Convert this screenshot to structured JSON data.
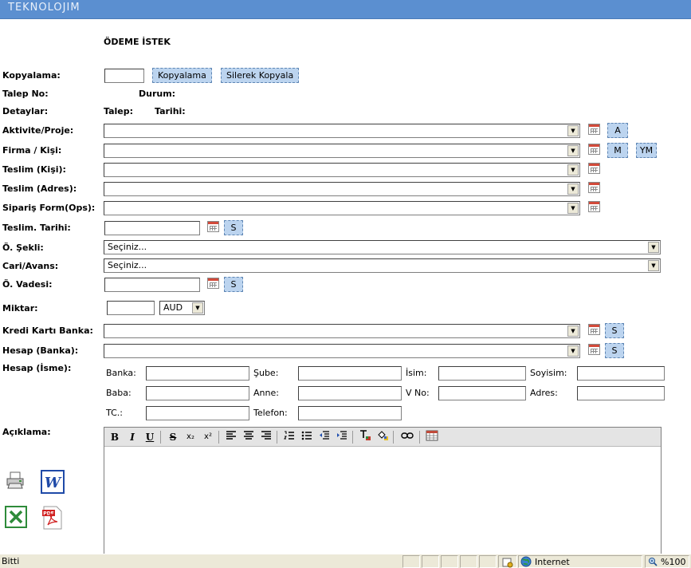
{
  "brand": "TEKNOLOJIM",
  "form_title": "ÖDEME İSTEK",
  "labels": {
    "kopyalama": "Kopyalama:",
    "talep_no": "Talep No:",
    "durum": "Durum:",
    "detaylar": "Detaylar:",
    "talep": "Talep:",
    "tarihi": "Tarihi:",
    "aktivite": "Aktivite/Proje:",
    "firma": "Firma / Kişi:",
    "teslim_kisi": "Teslim (Kişi):",
    "teslim_adres": "Teslim (Adres):",
    "siparis": "Sipariş Form(Ops):",
    "teslim_tarihi": "Teslim. Tarihi:",
    "o_sekli": "Ö. Şekli:",
    "cari": "Cari/Avans:",
    "o_vadesi": "Ö. Vadesi:",
    "miktar": "Miktar:",
    "kredi": "Kredi Kartı Banka:",
    "hesap_banka": "Hesap (Banka):",
    "hesap_isme": "Hesap (İsme):",
    "aciklama": "Açıklama:"
  },
  "buttons": {
    "kopyalama": "Kopyalama",
    "silerek": "Silerek Kopyala",
    "a": "A",
    "m": "M",
    "ym": "YM",
    "s": "S"
  },
  "selects": {
    "o_sekli": "Seçiniz...",
    "cari": "Seçiniz...",
    "currency": "AUD"
  },
  "hesap_fields": {
    "banka": "Banka:",
    "sube": "Şube:",
    "isim": "İsim:",
    "soyisim": "Soyisim:",
    "baba": "Baba:",
    "anne": "Anne:",
    "v_no": "V No:",
    "adres": "Adres:",
    "tc": "TC.:",
    "telefon": "Telefon:"
  },
  "toolbar": {
    "bold": "B",
    "italic": "I",
    "underline": "U",
    "strike": "S",
    "sub": "x₂",
    "sup": "x²"
  },
  "status": {
    "left": "Bitti",
    "zone": "Internet",
    "zoom": "%100"
  }
}
